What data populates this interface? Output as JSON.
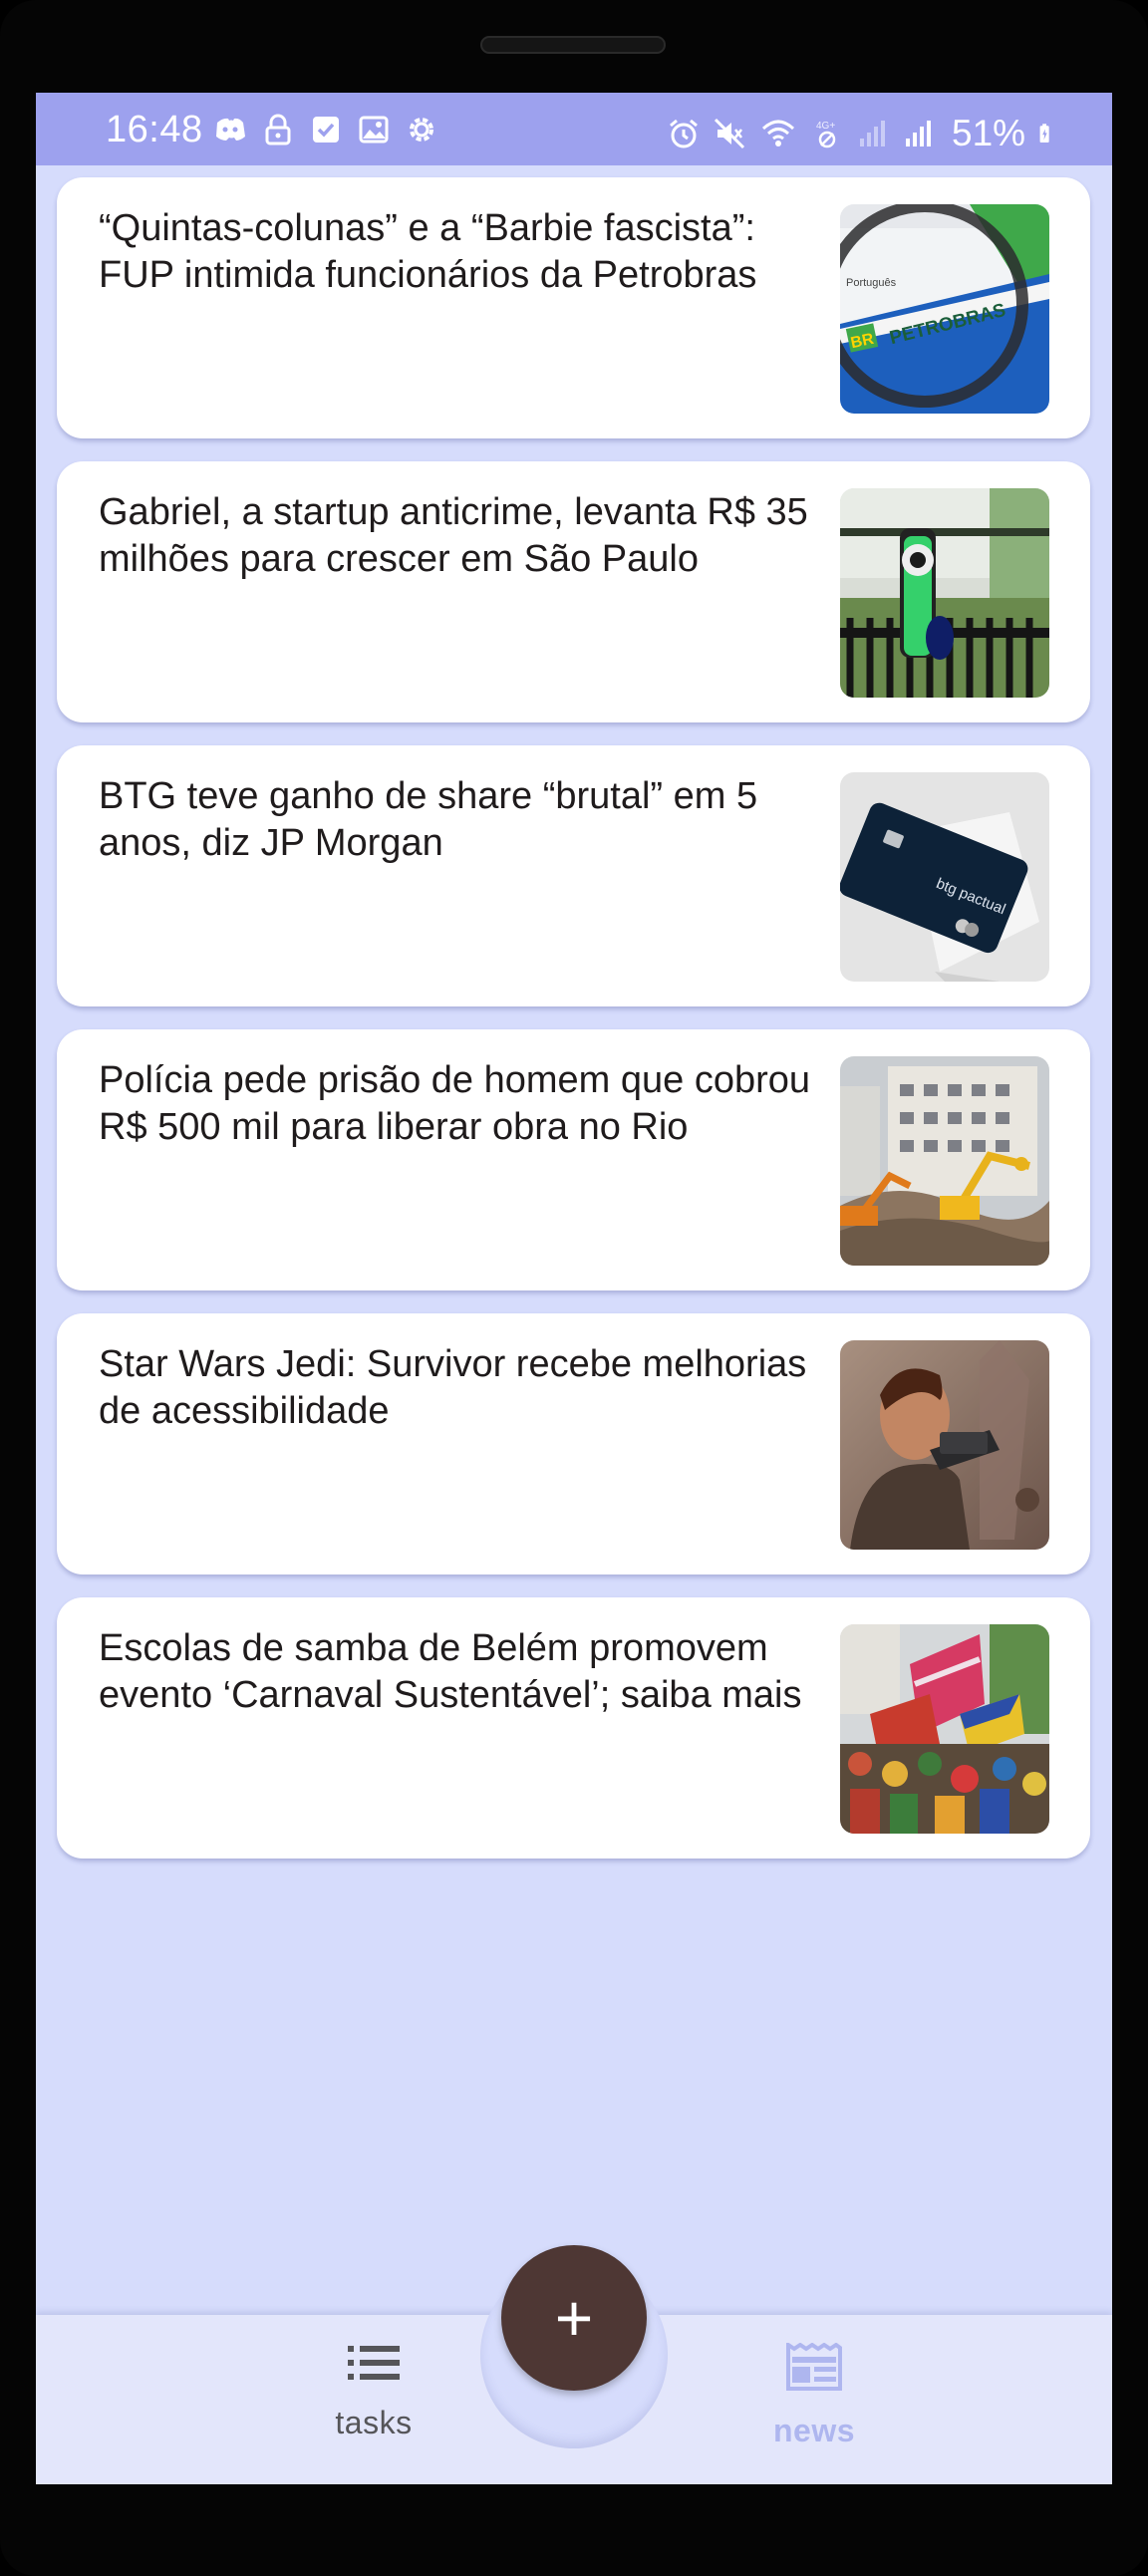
{
  "status_bar": {
    "time": "16:48",
    "battery": "51%",
    "left_icons": [
      "discord-icon",
      "lock-icon",
      "check-box-icon",
      "image-icon",
      "settings-icon"
    ],
    "right_icons": [
      "alarm-icon",
      "mute-icon",
      "wifi-icon",
      "data-off-icon",
      "signal-icon",
      "signal-icon",
      "battery-icon"
    ]
  },
  "news": {
    "items": [
      {
        "title": "“Quintas-colunas” e a “Barbie fascista”: FUP intimida funcionários da Petrobras",
        "thumbnail": "petrobras-magnifier-image",
        "thumb_text": "PETROBRAS"
      },
      {
        "title": "Gabriel, a startup anticrime, levanta R$ 35 milhões para crescer em São Paulo",
        "thumbnail": "security-camera-image"
      },
      {
        "title": "BTG teve ganho de share “brutal” em 5 anos, diz JP Morgan",
        "thumbnail": "credit-card-image",
        "thumb_text": "btg pactual"
      },
      {
        "title": "Polícia pede prisão de homem que cobrou R$ 500 mil para liberar obra no Rio",
        "thumbnail": "demolition-site-image"
      },
      {
        "title": "Star Wars Jedi: Survivor recebe melhorias de acessibilidade",
        "thumbnail": "jedi-character-image"
      },
      {
        "title": "Escolas de samba de Belém promovem evento ‘Carnaval Sustentável’; saiba mais",
        "thumbnail": "carnival-flags-image"
      }
    ]
  },
  "fab": {
    "label": "+"
  },
  "bottom_nav": {
    "tasks_label": "tasks",
    "news_label": "news",
    "active": "news"
  },
  "colors": {
    "status_bar": "#9da1ee",
    "background": "#d6dcfc",
    "card": "#ffffff",
    "fab": "#4e3734",
    "bottom_nav": "#e3e6fb",
    "active_tab": "#aeb6ef",
    "inactive_tab": "#555559"
  }
}
